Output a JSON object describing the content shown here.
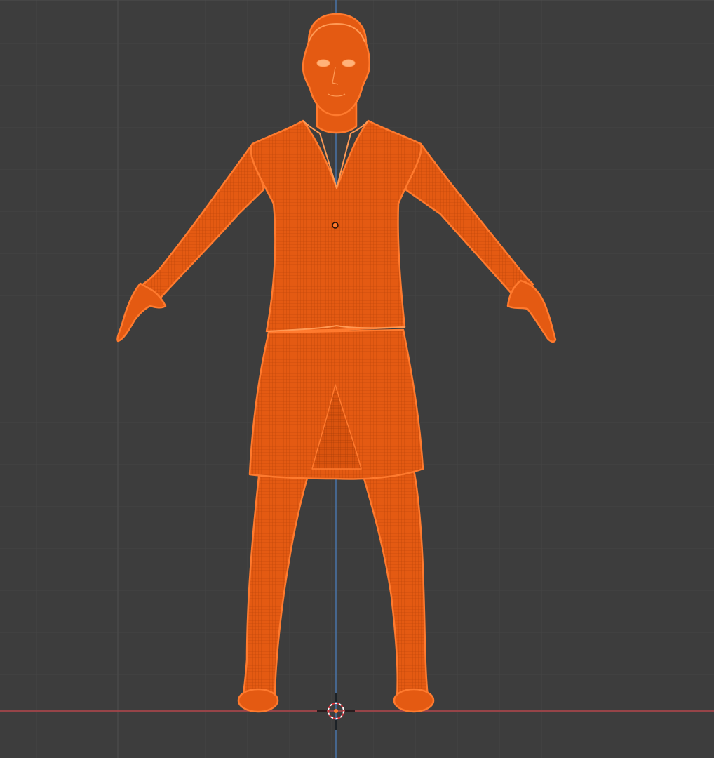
{
  "viewport": {
    "view": "front-orthographic",
    "shading": "wireframe",
    "object_selected": true
  },
  "colors": {
    "background": "#3d3d3d",
    "grid_minor": "#454545",
    "grid_major": "#4f4f4f",
    "axis_x": "#b3464c",
    "axis_z": "#4a78b0",
    "selection_fill": "#e0560f",
    "selection_outline": "#ff7a2e",
    "wire_dark": "#3a1a08"
  },
  "icons": {
    "origin": "origin-dot-icon",
    "cursor": "3d-cursor-icon"
  }
}
